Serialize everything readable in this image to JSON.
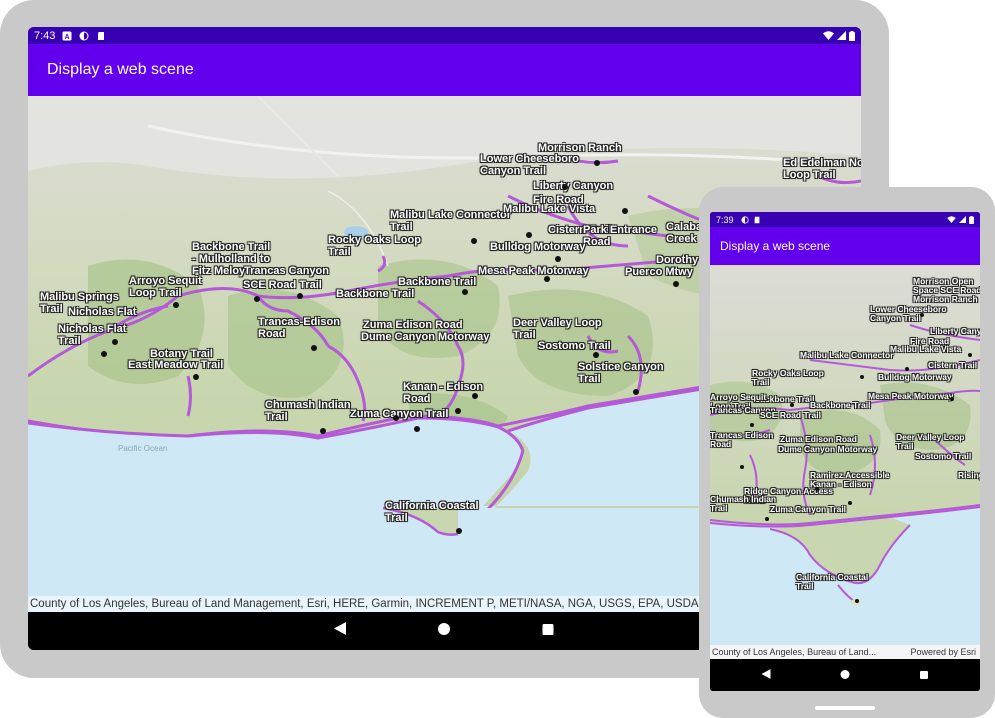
{
  "tablet": {
    "status": {
      "time": "7:43"
    },
    "app_title": "Display a web scene",
    "attribution": "County of Los Angeles, Bureau of Land Management, Esri, HERE, Garmin, INCREMENT P, METI/NASA, NGA, USGS, EPA, USDA",
    "ocean_label": "Pacific Ocean",
    "labels": [
      "Morrison Ranch",
      "Lower Cheeseboro\nCanyon Trail",
      "Liberty Canyon",
      "Ed Edelman No\nLoop Trail",
      "Fire Road",
      "Malibu Lake Connector\nTrail",
      "Malibu Lake Vista",
      "Cistern Trail",
      "Park Entrance\nRoad",
      "Calaba\nCreek",
      "Bulldog Motorway",
      "Mesa Peak Motorway",
      "Puerco Mtwy",
      "Dorothy Dr",
      "Rocky Oaks Loop\nTrail",
      "Backbone Trail\n- Mulholland to\nFitz Meloy",
      "Trancas Canyon",
      "Arroyo Sequit\nLoop Trail",
      "SCE Road Trail",
      "Backbone Trail",
      "Backbone Trail",
      "Malibu Springs\nTrail",
      "Nicholas Flat",
      "Nicholas Flat\nTrail",
      "Trancas-Edison\nRoad",
      "Zuma Edison Road",
      "Dume Canyon Motorway",
      "Deer Valley Loop\nTrail",
      "Solstice Canyon\nTrail",
      "Sostomo Trail",
      "Botany Trail",
      "East Meadow Trail",
      "Kanan - Edison\nRoad",
      "Chumash Indian\nTrail",
      "Zuma Canyon Trail",
      "California Coastal\nTrail"
    ]
  },
  "phone": {
    "status": {
      "time": "7:39"
    },
    "app_title": "Display a web scene",
    "attribution": "County of Los Angeles, Bureau of Land...",
    "powered_by": "Powered by Esri",
    "labels": [
      "Morrison Open\nSpace SCE Road\nMorrison Ranch",
      "Lower Cheeseboro\nCanyon Trail",
      "Liberty Canyon",
      "Fire Road",
      "Malibu Lake Connector",
      "Malibu Lake Vista",
      "Cistern Trail",
      "Rocky Oaks Loop\nTrail",
      "Bulldog Motorway",
      "Mesa Peak Motorway",
      "Backbone Trail",
      "Backbone Trail",
      "Arroyo Sequit\nLoop Trail",
      "Trancas Canyon",
      "SCE Road Trail",
      "Trancas-Edison\nRoad",
      "Zuma Edison Road",
      "Dume Canyon Motorway",
      "Deer Valley Loop\nTrail",
      "Sostomo Trail",
      "Ramirez Accessible\nKanan - Edison",
      "Rising Sun T",
      "Ridge Canyon Access\nRoad",
      "Chumash Indian\nTrail",
      "Zuma Canyon Trail",
      "California Coastal\nTrail"
    ]
  }
}
